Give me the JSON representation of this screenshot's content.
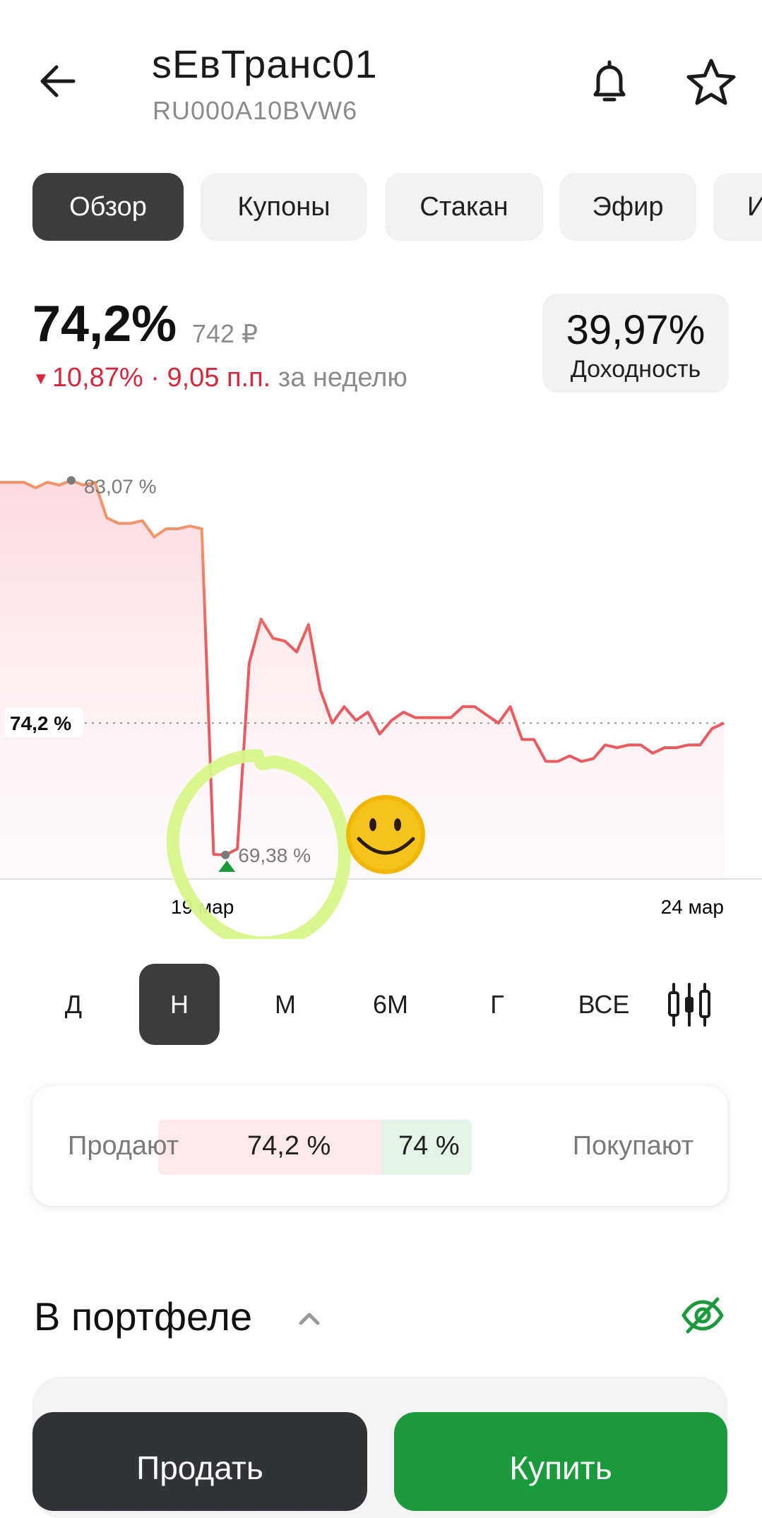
{
  "header": {
    "title": "sЕвТранс01",
    "isin": "RU000A10BVW6",
    "back_icon": "arrow-left-icon",
    "bell_icon": "bell-icon",
    "star_icon": "star-icon"
  },
  "tabs": [
    {
      "label": "Обзор",
      "active": true
    },
    {
      "label": "Купоны",
      "active": false
    },
    {
      "label": "Стакан",
      "active": false
    },
    {
      "label": "Эфир",
      "active": false
    },
    {
      "label": "И",
      "active": false
    }
  ],
  "price": {
    "percent": "74,2%",
    "rub": "742 ₽",
    "change_percent": "10,87%",
    "change_separator": " · ",
    "change_points": "9,05 п.п.",
    "change_period": "за неделю",
    "change_color": "#d6283a"
  },
  "yield": {
    "value": "39,97%",
    "label": "Доходность"
  },
  "chart_data": {
    "type": "area",
    "current_label": "74,2 %",
    "max_label": "83,07 %",
    "min_label": "69,38 %",
    "x_ticks": [
      "19 мар",
      "24 мар"
    ],
    "current_value": 74.2,
    "max_value": 83.07,
    "min_value": 69.38,
    "ylim": [
      68.5,
      84.5
    ],
    "line_color_high": "#f0956a",
    "line_color_low": "#ea5a5f",
    "values": [
      83.0,
      83.0,
      83.0,
      82.8,
      83.0,
      82.9,
      83.07,
      82.9,
      83.0,
      81.7,
      81.5,
      81.5,
      81.6,
      81.0,
      81.3,
      81.3,
      81.4,
      81.3,
      69.4,
      69.38,
      69.6,
      76.4,
      78.0,
      77.3,
      77.2,
      76.8,
      77.8,
      75.4,
      74.2,
      74.8,
      74.3,
      74.6,
      73.8,
      74.3,
      74.6,
      74.4,
      74.4,
      74.4,
      74.4,
      74.8,
      74.8,
      74.5,
      74.2,
      74.8,
      73.6,
      73.6,
      72.8,
      72.8,
      73.0,
      72.8,
      72.9,
      73.4,
      73.3,
      73.4,
      73.4,
      73.1,
      73.3,
      73.3,
      73.4,
      73.4,
      74.0,
      74.2
    ]
  },
  "periods": [
    {
      "label": "Д",
      "active": false
    },
    {
      "label": "Н",
      "active": true
    },
    {
      "label": "М",
      "active": false
    },
    {
      "label": "6М",
      "active": false
    },
    {
      "label": "Г",
      "active": false
    },
    {
      "label": "ВСЕ",
      "active": false
    }
  ],
  "candles_icon": "candlestick-icon",
  "order_book": {
    "sell_label": "Продают",
    "sell_value": "74,2 %",
    "buy_value": "74 %",
    "buy_label": "Покупают"
  },
  "portfolio": {
    "title": "В портфеле",
    "chevron_icon": "chevron-up-icon",
    "eye_icon": "eye-off-icon"
  },
  "actions": {
    "sell": "Продать",
    "buy": "Купить"
  },
  "colors": {
    "accent_green": "#1b9a3b",
    "dark": "#303338",
    "sell_red": "#d6283a",
    "annotation_green": "#d8f58a",
    "emoji_yellow": "#f2b705"
  }
}
